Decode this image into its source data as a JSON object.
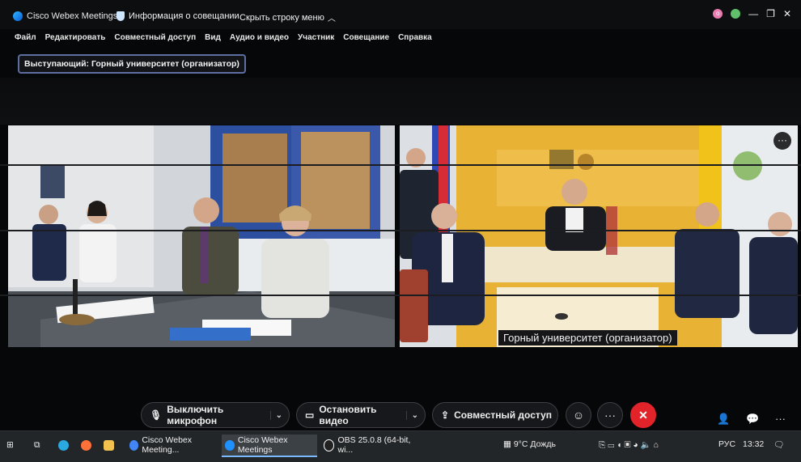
{
  "titlebar": {
    "app_name": "Cisco Webex Meetings",
    "meeting_info": "Информация о совещании",
    "hide_menu": "Скрыть строку меню",
    "avatar_initial": "о"
  },
  "menu": [
    "Файл",
    "Редактировать",
    "Совместный доступ",
    "Вид",
    "Аудио и видео",
    "Участник",
    "Совещание",
    "Справка"
  ],
  "speaker": "Выступающий: Горный университет (организатор)",
  "right_tile": {
    "name_label": "Горный университет (организатор)",
    "more": "···"
  },
  "controls": {
    "mute": "Выключить микрофон",
    "video": "Остановить видео",
    "share": "Совместный доступ",
    "more": "···",
    "end": "✕",
    "caret": "⌄"
  },
  "taskbar": {
    "items": [
      {
        "label": "Cisco Webex Meeting...",
        "color": "#4285f4"
      },
      {
        "label": "Cisco Webex Meetings",
        "color": "#1e90ff"
      },
      {
        "label": "OBS 25.0.8 (64-bit, wi...",
        "color": "#ffffff"
      }
    ],
    "weather": "9°C  Дождь",
    "lang": "РУС",
    "time": "13:32"
  },
  "colors": {
    "end_call": "#e2232a",
    "accent": "#5f6ea0"
  }
}
